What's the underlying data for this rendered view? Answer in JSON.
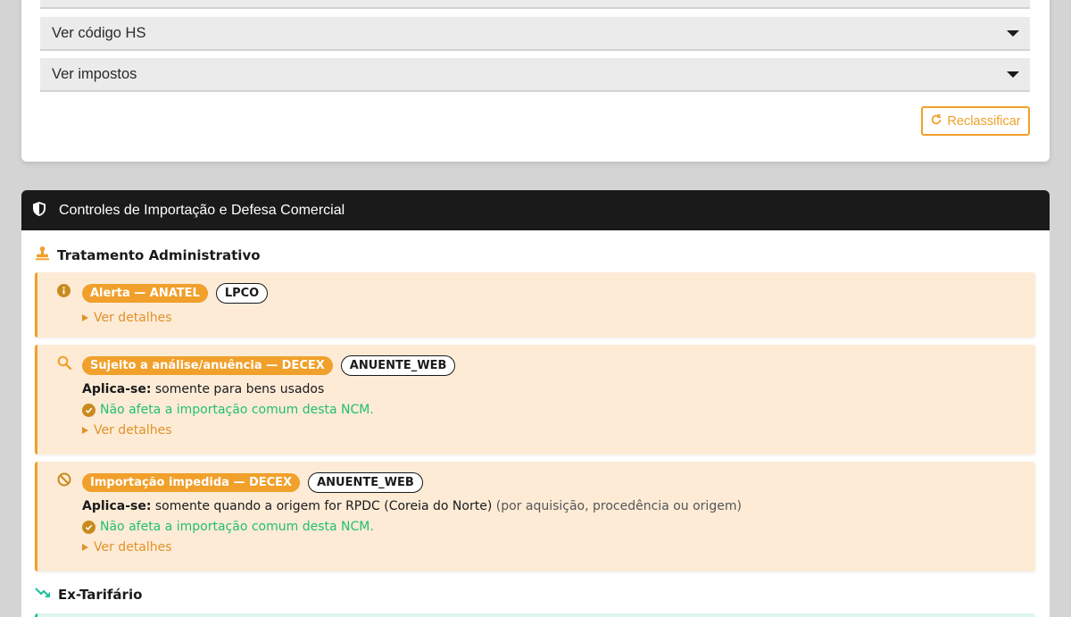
{
  "top_card": {
    "accordions": [
      {
        "label": "Ver código HS"
      },
      {
        "label": "Ver impostos"
      }
    ],
    "reclassify_label": "Reclassificar"
  },
  "controls_card": {
    "header_title": "Controles de Importação e Defesa Comercial",
    "admin_section_title": "Tratamento Administrativo",
    "items": [
      {
        "badge": "Alerta — ANATEL",
        "tag": "LPCO",
        "details_label": "Ver detalhes"
      },
      {
        "badge": "Sujeito a análise/anuência — DECEX",
        "tag": "ANUENTE_WEB",
        "applies_label": "Aplica-se:",
        "applies_text": "somente para bens usados",
        "ok_text": "Não afeta a importação comum desta NCM.",
        "details_label": "Ver detalhes"
      },
      {
        "badge": "Importação impedida — DECEX",
        "tag": "ANUENTE_WEB",
        "applies_label": "Aplica-se:",
        "applies_text": "somente quando a origem for RPDC (Coreia do Norte)",
        "applies_note": "(por aquisição, procedência ou origem)",
        "ok_text": "Não afeta a importação comum desta NCM.",
        "details_label": "Ver detalhes"
      }
    ],
    "ex_section_title": "Ex-Tarifário"
  },
  "icons": {
    "shield": "shield-icon",
    "stamp": "stamp-icon",
    "info": "info-icon",
    "search": "search-icon",
    "ban": "ban-icon",
    "check": "check-circle-icon",
    "trend_down": "trend-down-icon",
    "refresh": "refresh-icon",
    "caret": "caret-down-icon"
  },
  "colors": {
    "accent": "#f0a02b",
    "success": "#22bf6d",
    "header_bg": "#1a1a1a",
    "control_bg": "#fdebd6",
    "ex_accent": "#20c5a0"
  }
}
